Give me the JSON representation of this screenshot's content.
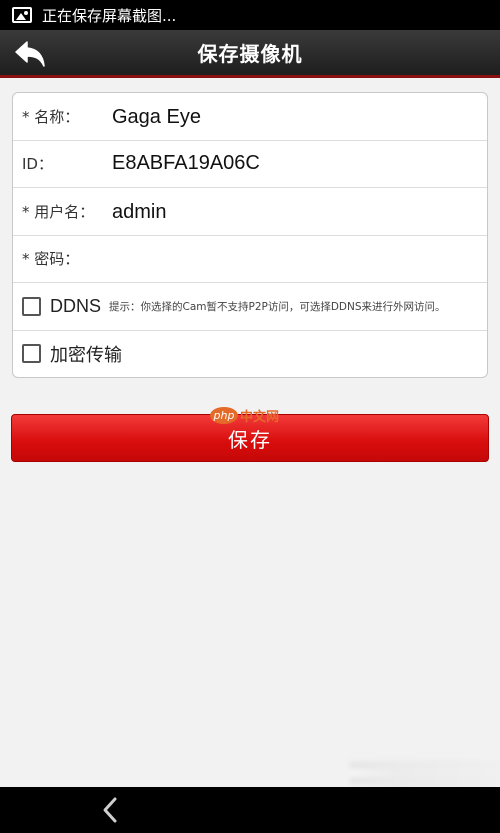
{
  "status_bar": {
    "text": "正在保存屏幕截图...",
    "icon": "image-icon"
  },
  "header": {
    "title": "保存摄像机",
    "back_icon": "back-arrow-icon"
  },
  "form": {
    "name": {
      "label": "* 名称：",
      "value": "Gaga Eye"
    },
    "id": {
      "label": "ID：",
      "value": "E8ABFA19A06C"
    },
    "username": {
      "label": "* 用户名：",
      "value": "admin"
    },
    "password": {
      "label": "* 密码：",
      "value": ""
    },
    "ddns": {
      "label": "DDNS",
      "checked": false,
      "hint": "提示：你选择的Cam暂不支持P2P访问，可选择DDNS来进行外网访问。"
    },
    "encrypt": {
      "label": "加密传输",
      "checked": false
    }
  },
  "save_button": {
    "label": "保存"
  },
  "watermark": {
    "badge": "php",
    "text": "中文网"
  },
  "nav_bar": {
    "back_icon": "nav-back-icon"
  },
  "colors": {
    "accent": "#d80c0c",
    "header_bg": "#2a2a2a",
    "header_border": "#8a1010",
    "page_bg": "#f2f2f2"
  }
}
